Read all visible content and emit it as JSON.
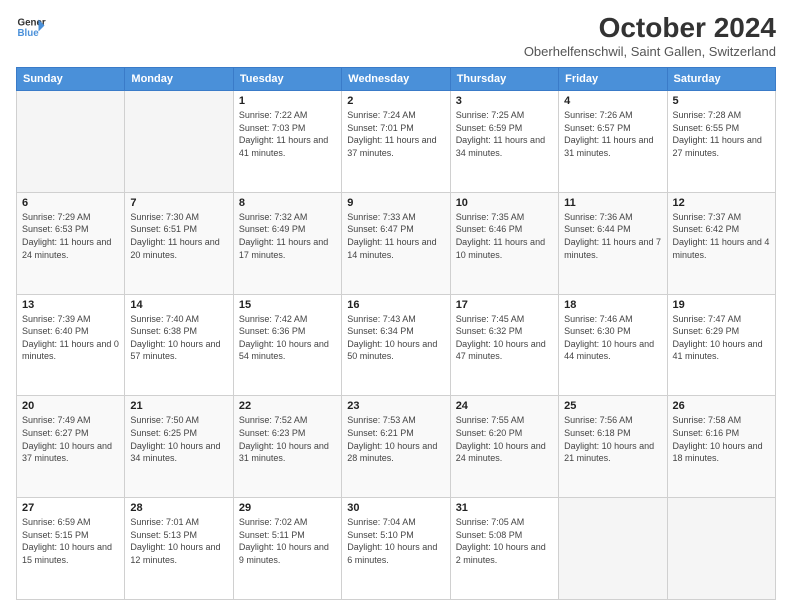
{
  "header": {
    "logo_line1": "General",
    "logo_line2": "Blue",
    "title": "October 2024",
    "subtitle": "Oberhelfenschwil, Saint Gallen, Switzerland"
  },
  "days_of_week": [
    "Sunday",
    "Monday",
    "Tuesday",
    "Wednesday",
    "Thursday",
    "Friday",
    "Saturday"
  ],
  "weeks": [
    [
      {
        "day": "",
        "sunrise": "",
        "sunset": "",
        "daylight": ""
      },
      {
        "day": "",
        "sunrise": "",
        "sunset": "",
        "daylight": ""
      },
      {
        "day": "1",
        "sunrise": "Sunrise: 7:22 AM",
        "sunset": "Sunset: 7:03 PM",
        "daylight": "Daylight: 11 hours and 41 minutes."
      },
      {
        "day": "2",
        "sunrise": "Sunrise: 7:24 AM",
        "sunset": "Sunset: 7:01 PM",
        "daylight": "Daylight: 11 hours and 37 minutes."
      },
      {
        "day": "3",
        "sunrise": "Sunrise: 7:25 AM",
        "sunset": "Sunset: 6:59 PM",
        "daylight": "Daylight: 11 hours and 34 minutes."
      },
      {
        "day": "4",
        "sunrise": "Sunrise: 7:26 AM",
        "sunset": "Sunset: 6:57 PM",
        "daylight": "Daylight: 11 hours and 31 minutes."
      },
      {
        "day": "5",
        "sunrise": "Sunrise: 7:28 AM",
        "sunset": "Sunset: 6:55 PM",
        "daylight": "Daylight: 11 hours and 27 minutes."
      }
    ],
    [
      {
        "day": "6",
        "sunrise": "Sunrise: 7:29 AM",
        "sunset": "Sunset: 6:53 PM",
        "daylight": "Daylight: 11 hours and 24 minutes."
      },
      {
        "day": "7",
        "sunrise": "Sunrise: 7:30 AM",
        "sunset": "Sunset: 6:51 PM",
        "daylight": "Daylight: 11 hours and 20 minutes."
      },
      {
        "day": "8",
        "sunrise": "Sunrise: 7:32 AM",
        "sunset": "Sunset: 6:49 PM",
        "daylight": "Daylight: 11 hours and 17 minutes."
      },
      {
        "day": "9",
        "sunrise": "Sunrise: 7:33 AM",
        "sunset": "Sunset: 6:47 PM",
        "daylight": "Daylight: 11 hours and 14 minutes."
      },
      {
        "day": "10",
        "sunrise": "Sunrise: 7:35 AM",
        "sunset": "Sunset: 6:46 PM",
        "daylight": "Daylight: 11 hours and 10 minutes."
      },
      {
        "day": "11",
        "sunrise": "Sunrise: 7:36 AM",
        "sunset": "Sunset: 6:44 PM",
        "daylight": "Daylight: 11 hours and 7 minutes."
      },
      {
        "day": "12",
        "sunrise": "Sunrise: 7:37 AM",
        "sunset": "Sunset: 6:42 PM",
        "daylight": "Daylight: 11 hours and 4 minutes."
      }
    ],
    [
      {
        "day": "13",
        "sunrise": "Sunrise: 7:39 AM",
        "sunset": "Sunset: 6:40 PM",
        "daylight": "Daylight: 11 hours and 0 minutes."
      },
      {
        "day": "14",
        "sunrise": "Sunrise: 7:40 AM",
        "sunset": "Sunset: 6:38 PM",
        "daylight": "Daylight: 10 hours and 57 minutes."
      },
      {
        "day": "15",
        "sunrise": "Sunrise: 7:42 AM",
        "sunset": "Sunset: 6:36 PM",
        "daylight": "Daylight: 10 hours and 54 minutes."
      },
      {
        "day": "16",
        "sunrise": "Sunrise: 7:43 AM",
        "sunset": "Sunset: 6:34 PM",
        "daylight": "Daylight: 10 hours and 50 minutes."
      },
      {
        "day": "17",
        "sunrise": "Sunrise: 7:45 AM",
        "sunset": "Sunset: 6:32 PM",
        "daylight": "Daylight: 10 hours and 47 minutes."
      },
      {
        "day": "18",
        "sunrise": "Sunrise: 7:46 AM",
        "sunset": "Sunset: 6:30 PM",
        "daylight": "Daylight: 10 hours and 44 minutes."
      },
      {
        "day": "19",
        "sunrise": "Sunrise: 7:47 AM",
        "sunset": "Sunset: 6:29 PM",
        "daylight": "Daylight: 10 hours and 41 minutes."
      }
    ],
    [
      {
        "day": "20",
        "sunrise": "Sunrise: 7:49 AM",
        "sunset": "Sunset: 6:27 PM",
        "daylight": "Daylight: 10 hours and 37 minutes."
      },
      {
        "day": "21",
        "sunrise": "Sunrise: 7:50 AM",
        "sunset": "Sunset: 6:25 PM",
        "daylight": "Daylight: 10 hours and 34 minutes."
      },
      {
        "day": "22",
        "sunrise": "Sunrise: 7:52 AM",
        "sunset": "Sunset: 6:23 PM",
        "daylight": "Daylight: 10 hours and 31 minutes."
      },
      {
        "day": "23",
        "sunrise": "Sunrise: 7:53 AM",
        "sunset": "Sunset: 6:21 PM",
        "daylight": "Daylight: 10 hours and 28 minutes."
      },
      {
        "day": "24",
        "sunrise": "Sunrise: 7:55 AM",
        "sunset": "Sunset: 6:20 PM",
        "daylight": "Daylight: 10 hours and 24 minutes."
      },
      {
        "day": "25",
        "sunrise": "Sunrise: 7:56 AM",
        "sunset": "Sunset: 6:18 PM",
        "daylight": "Daylight: 10 hours and 21 minutes."
      },
      {
        "day": "26",
        "sunrise": "Sunrise: 7:58 AM",
        "sunset": "Sunset: 6:16 PM",
        "daylight": "Daylight: 10 hours and 18 minutes."
      }
    ],
    [
      {
        "day": "27",
        "sunrise": "Sunrise: 6:59 AM",
        "sunset": "Sunset: 5:15 PM",
        "daylight": "Daylight: 10 hours and 15 minutes."
      },
      {
        "day": "28",
        "sunrise": "Sunrise: 7:01 AM",
        "sunset": "Sunset: 5:13 PM",
        "daylight": "Daylight: 10 hours and 12 minutes."
      },
      {
        "day": "29",
        "sunrise": "Sunrise: 7:02 AM",
        "sunset": "Sunset: 5:11 PM",
        "daylight": "Daylight: 10 hours and 9 minutes."
      },
      {
        "day": "30",
        "sunrise": "Sunrise: 7:04 AM",
        "sunset": "Sunset: 5:10 PM",
        "daylight": "Daylight: 10 hours and 6 minutes."
      },
      {
        "day": "31",
        "sunrise": "Sunrise: 7:05 AM",
        "sunset": "Sunset: 5:08 PM",
        "daylight": "Daylight: 10 hours and 2 minutes."
      },
      {
        "day": "",
        "sunrise": "",
        "sunset": "",
        "daylight": ""
      },
      {
        "day": "",
        "sunrise": "",
        "sunset": "",
        "daylight": ""
      }
    ]
  ]
}
